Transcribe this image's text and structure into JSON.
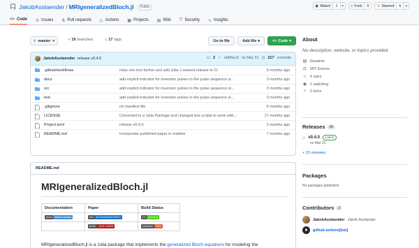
{
  "repo": {
    "owner": "JakobAsslaender",
    "separator": "/",
    "name": "MRIgeneralizedBloch.jl",
    "visibility": "Public"
  },
  "actions": {
    "watch": {
      "label": "Watch",
      "count": "1"
    },
    "fork": {
      "label": "Fork",
      "count": "0"
    },
    "star": {
      "label": "Starred",
      "count": "6"
    }
  },
  "tabs": [
    {
      "label": "Code",
      "icon": "code-icon"
    },
    {
      "label": "Issues",
      "icon": "issue-icon"
    },
    {
      "label": "Pull requests",
      "icon": "pull-request-icon"
    },
    {
      "label": "Actions",
      "icon": "play-icon"
    },
    {
      "label": "Projects",
      "icon": "project-icon"
    },
    {
      "label": "Wiki",
      "icon": "book-icon"
    },
    {
      "label": "Security",
      "icon": "shield-icon"
    },
    {
      "label": "Insights",
      "icon": "graph-icon"
    }
  ],
  "toolbar": {
    "branch": "master",
    "branches_count": "19",
    "branches_label": "branches",
    "tags_count": "17",
    "tags_label": "tags",
    "go_to_file": "Go to file",
    "add_file": "Add file",
    "code": "Code"
  },
  "commit": {
    "author": "JakobAsslaender",
    "message": "release v0.4.0",
    "comments": "2",
    "sha": "eb86ec3",
    "date": "on Mar 31",
    "commits_count": "217",
    "commits_label": "commits"
  },
  "files": [
    {
      "name": ".github/workflows",
      "type": "dir",
      "message": "relax one test further and add Julia 1.newest release to CI",
      "date": "5 months ago"
    },
    {
      "name": "docs",
      "type": "dir",
      "message": "add explicit indicator for inversion pulses to the pulse sequence si...",
      "date": "3 months ago"
    },
    {
      "name": "src",
      "type": "dir",
      "message": "add explicit indicator for inversion pulses to the pulse sequence si...",
      "date": "3 months ago"
    },
    {
      "name": "test",
      "type": "dir",
      "message": "add explicit indicator for inversion pulses to the pulse sequence si...",
      "date": "3 months ago"
    },
    {
      "name": ".gitignore",
      "type": "file",
      "message": "rm manifest file",
      "date": "6 months ago"
    },
    {
      "name": "LICENSE",
      "type": "file",
      "message": "Converted to a Julia Package and changed test scripts to work with...",
      "date": "17 months ago"
    },
    {
      "name": "Project.toml",
      "type": "file",
      "message": "release v0.4.0",
      "date": "3 months ago"
    },
    {
      "name": "README.md",
      "type": "file",
      "message": "Incorporate published paper in readme",
      "date": "7 months ago"
    }
  ],
  "readme": {
    "header": "README.md",
    "title": "MRIgeneralizedBloch.jl",
    "table": {
      "headers": [
        "Documentation",
        "Paper",
        "Build Status"
      ],
      "row1": {
        "doc_badge": {
          "left": "docs",
          "right": "latest release"
        },
        "paper_badge": {
          "left": "doi",
          "right": "10.1002/mrm.29071"
        },
        "build_badge": {
          "left": "CI",
          "right": "passing"
        }
      },
      "row2": {
        "paper_badge": {
          "left": "arXiv",
          "right": "2107.11000"
        },
        "build_badge": {
          "left": "codecov",
          "right": "74%"
        }
      }
    },
    "para_start": "MRIgeneralizedBloch.jl is a Julia package that implements the ",
    "para_link": "generalized Bloch equations",
    "para_end": " for modeling the"
  },
  "sidebar": {
    "about_title": "About",
    "description": "No description, website, or topics provided.",
    "items": [
      {
        "label": "Readme",
        "icon": "book-icon"
      },
      {
        "label": "MIT license",
        "icon": "law-icon"
      },
      {
        "label": "6 stars",
        "icon": "star-icon"
      },
      {
        "label": "1 watching",
        "icon": "eye-icon"
      },
      {
        "label": "0 forks",
        "icon": "fork-icon"
      }
    ],
    "releases_title": "Releases",
    "releases_count": "16",
    "latest_release": "v0.4.0",
    "latest_badge": "Latest",
    "release_date": "on Mar 31",
    "more_releases": "+ 15 releases",
    "packages_title": "Packages",
    "packages_text": "No packages published",
    "contributors_title": "Contributors",
    "contributors_count": "2",
    "contributors": [
      {
        "login": "JakobAsslaender",
        "name": "Jakob Assländer"
      },
      {
        "login": "github-actions[bot]",
        "name": ""
      }
    ]
  },
  "colors": {
    "accent": "#0969da",
    "green": "#2da44e",
    "tab_underline": "#fd8c73"
  }
}
